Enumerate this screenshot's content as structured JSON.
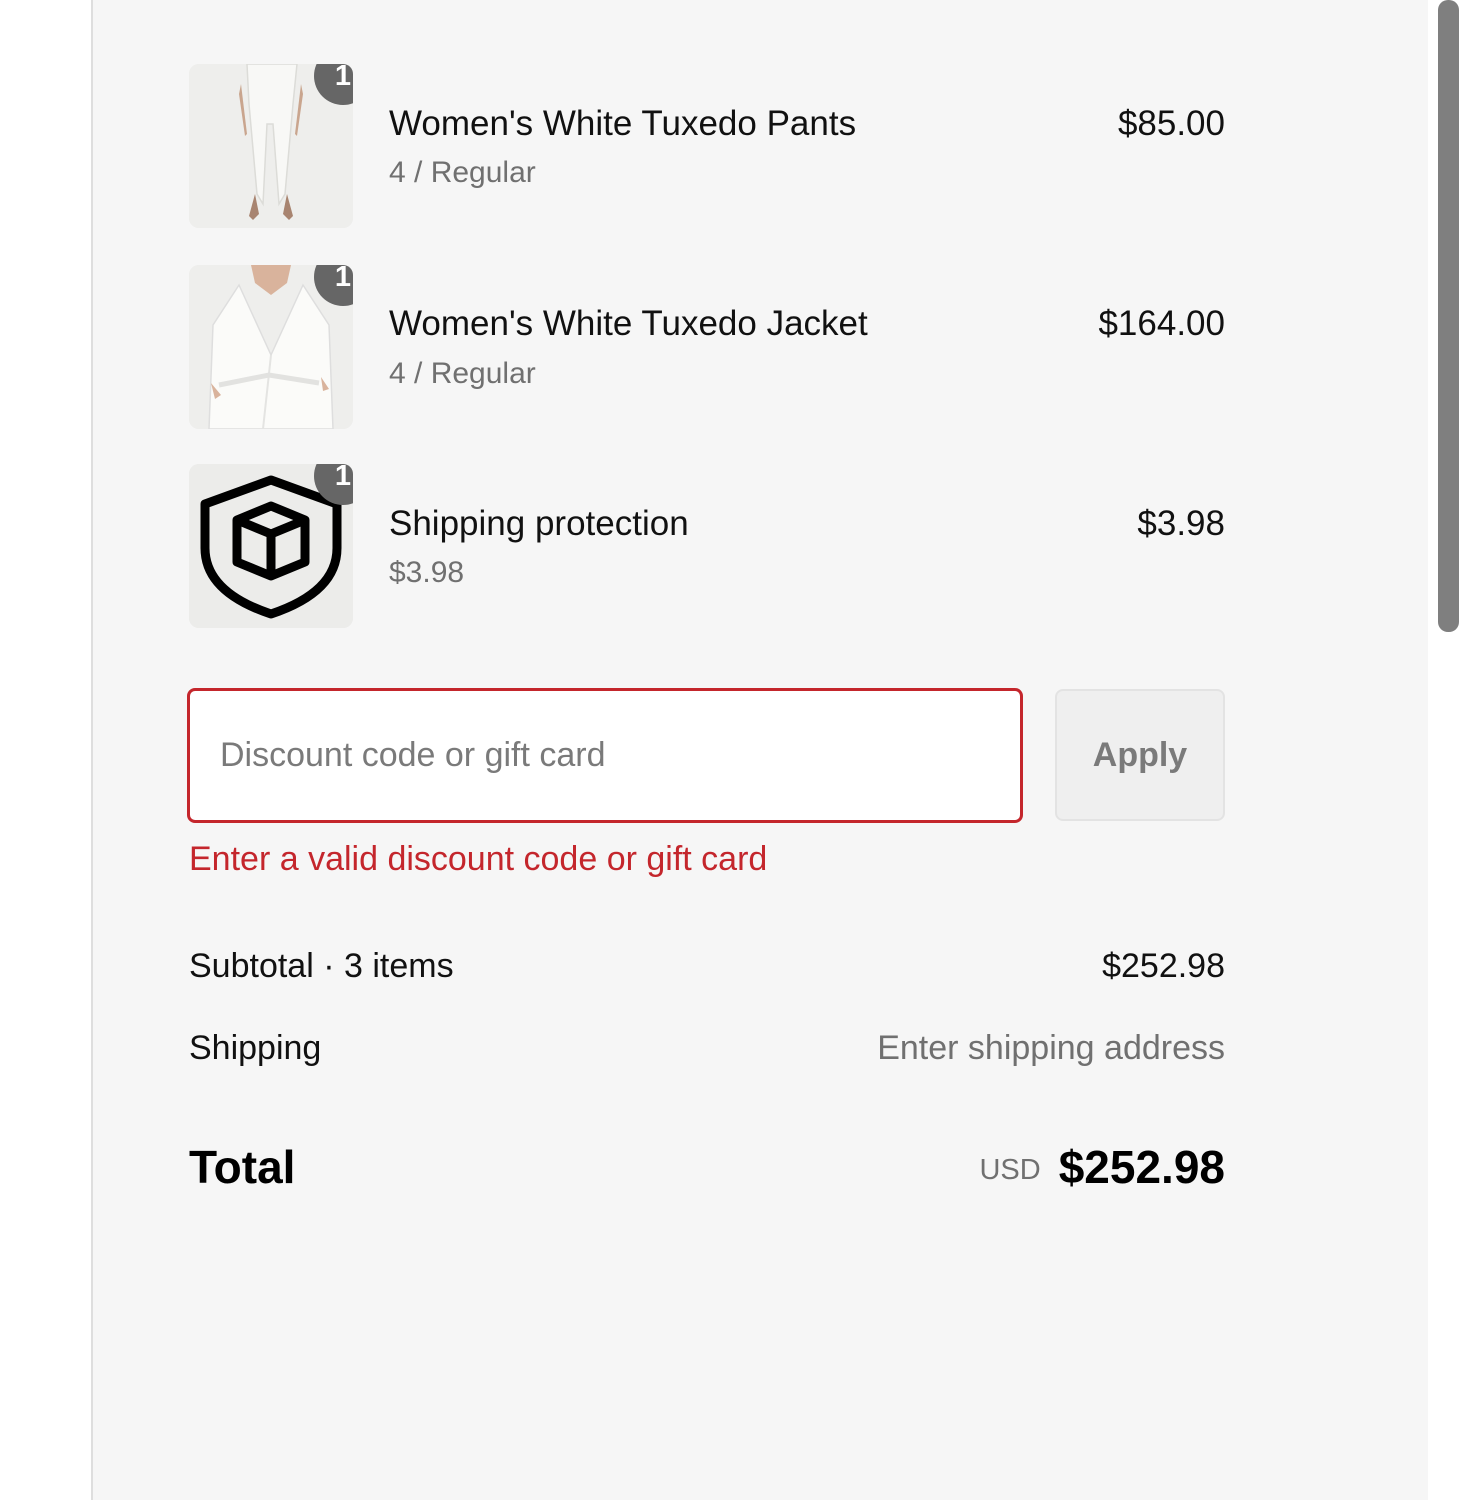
{
  "line_items": [
    {
      "name": "Women's White Tuxedo Pants",
      "variant": "4 / Regular",
      "price": "$85.00",
      "quantity": "1",
      "image_icon": "pants-product-photo"
    },
    {
      "name": "Women's White Tuxedo Jacket",
      "variant": "4 / Regular",
      "price": "$164.00",
      "quantity": "1",
      "image_icon": "jacket-product-photo"
    },
    {
      "name": "Shipping protection",
      "variant": "$3.98",
      "price": "$3.98",
      "quantity": "1",
      "image_icon": "shield-box-icon"
    }
  ],
  "discount": {
    "placeholder": "Discount code or gift card",
    "value": "",
    "apply_label": "Apply",
    "error": "Enter a valid discount code or gift card",
    "error_color": "#c4262c"
  },
  "summary": {
    "subtotal_label": "Subtotal · 3 items",
    "subtotal_value": "$252.98",
    "shipping_label": "Shipping",
    "shipping_value": "Enter shipping address",
    "total_label": "Total",
    "currency": "USD",
    "total_value": "$252.98"
  }
}
